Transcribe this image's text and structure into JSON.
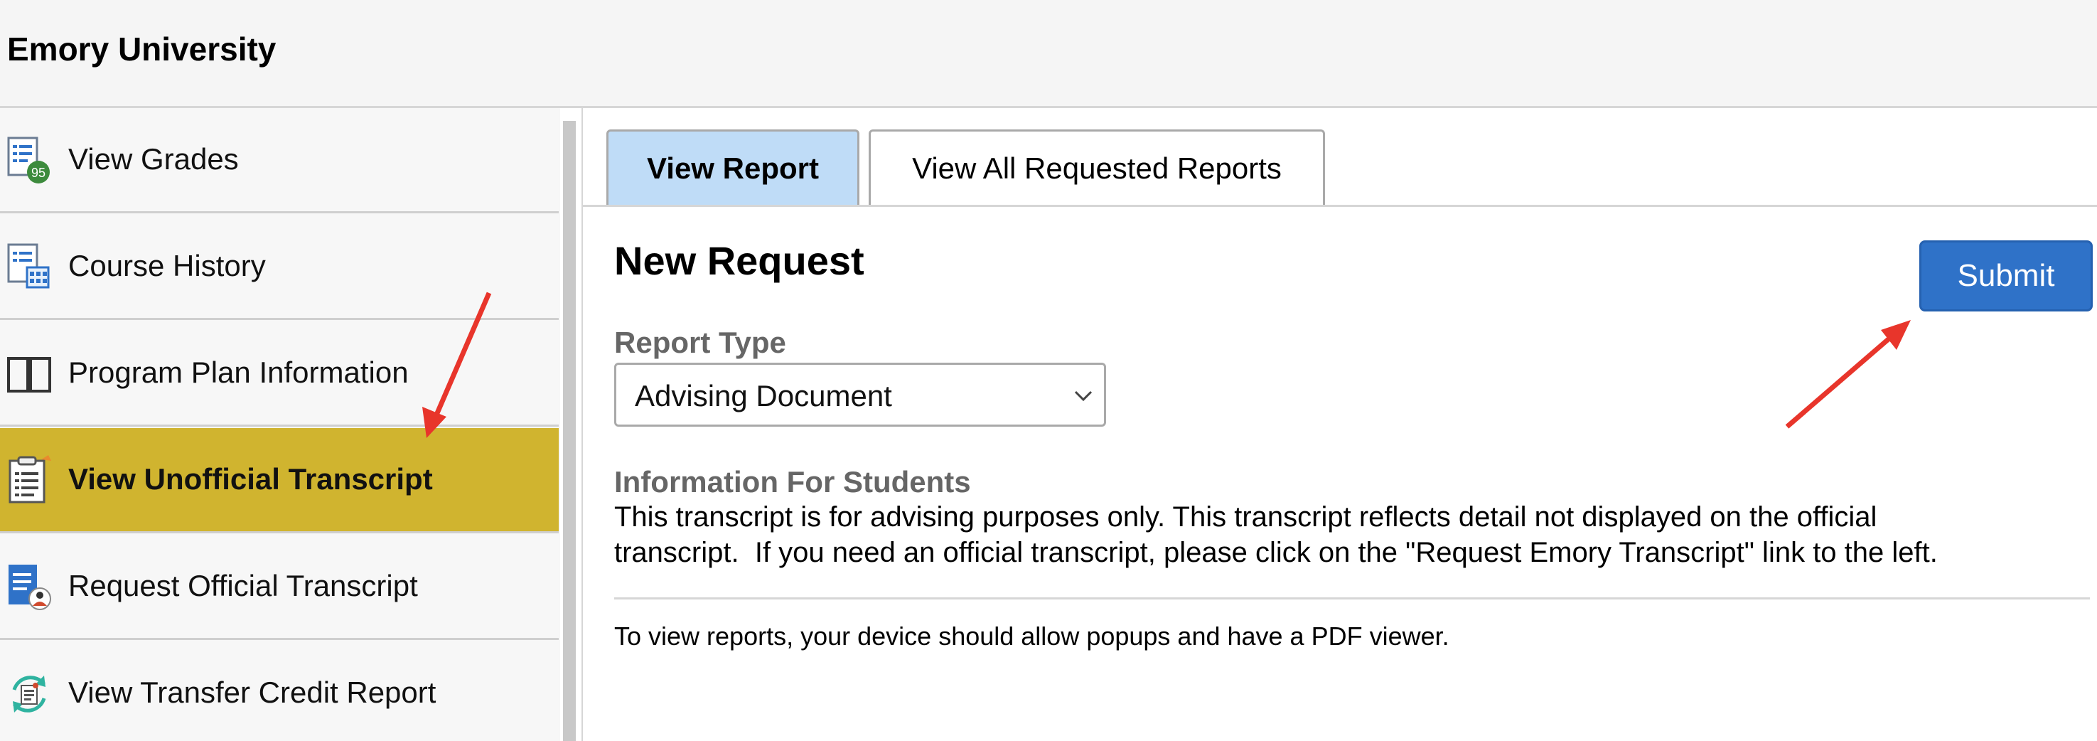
{
  "header": {
    "title": "Emory University"
  },
  "sidebar": {
    "items": [
      {
        "label": "View Grades",
        "icon": "grades-icon",
        "active": false
      },
      {
        "label": "Course History",
        "icon": "course-history-icon",
        "active": false
      },
      {
        "label": "Program Plan Information",
        "icon": "open-book-icon",
        "active": false
      },
      {
        "label": "View Unofficial Transcript",
        "icon": "transcript-icon",
        "active": true
      },
      {
        "label": "Request Official Transcript",
        "icon": "request-transcript-icon",
        "active": false
      },
      {
        "label": "View Transfer Credit Report",
        "icon": "transfer-credit-icon",
        "active": false
      }
    ],
    "grade_badge": "95"
  },
  "tabs": [
    {
      "label": "View Report",
      "active": true
    },
    {
      "label": "View All Requested Reports",
      "active": false
    }
  ],
  "main": {
    "title": "New Request",
    "submit_label": "Submit",
    "report_type_label": "Report Type",
    "report_type_value": "Advising Document",
    "info_heading": "Information For Students",
    "info_line1": "This transcript is for advising purposes only. This transcript reflects detail not displayed on the official",
    "info_line2": "transcript.  If you need an official transcript, please click on the \"Request Emory Transcript\" link to the left.",
    "note": "To view reports, your device should allow popups and have a PDF viewer."
  },
  "colors": {
    "active_sidebar": "#d0b42f",
    "active_tab": "#bfdcf7",
    "submit": "#2f72c8",
    "annotation_arrow": "#e8352b"
  }
}
